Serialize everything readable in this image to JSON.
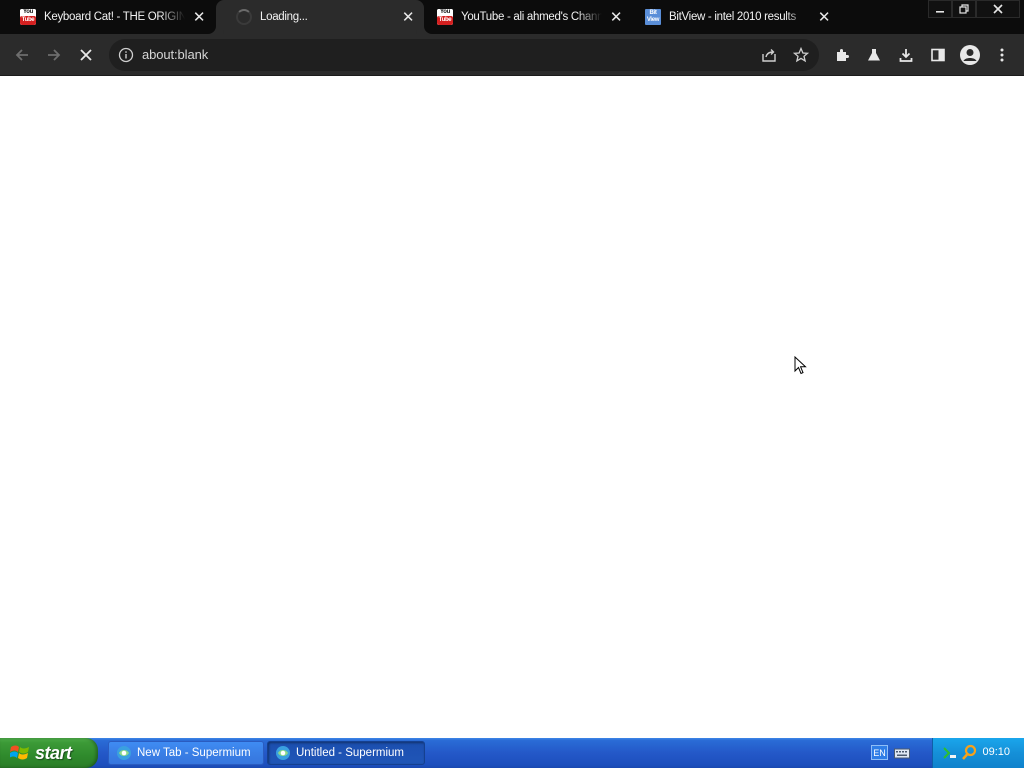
{
  "browser": {
    "tabs": [
      {
        "title": "Keyboard Cat! - THE ORIGINAL!",
        "favicon": "youtube-favicon",
        "active": false
      },
      {
        "title": "Loading...",
        "favicon": "loading-spinner",
        "active": true
      },
      {
        "title": "YouTube - ali ahmed's Channel",
        "favicon": "youtube-favicon",
        "active": false
      },
      {
        "title": "BitView - intel 2010 results",
        "favicon": "bitview-favicon",
        "active": false
      }
    ],
    "favicon_text": {
      "yt_top": "You",
      "yt_bottom": "Tube",
      "bitview": "Bit View"
    },
    "address": "about:blank",
    "window_controls": [
      "minimize",
      "restore",
      "close"
    ],
    "toolbar_icons": [
      "back-icon",
      "forward-icon",
      "stop-icon",
      "info-icon",
      "share-icon",
      "star-icon",
      "extensions-icon",
      "labs-icon",
      "download-icon",
      "side-panel-icon",
      "profile-icon",
      "menu-icon"
    ]
  },
  "taskbar": {
    "start_label": "start",
    "tasks": [
      {
        "label": "New Tab - Supermium",
        "active": false
      },
      {
        "label": "Untitled - Supermium",
        "active": true
      }
    ],
    "language": "EN",
    "clock": "09:10"
  },
  "colors": {
    "tabstrip_bg": "#0c0c0c",
    "toolbar_bg": "#2b2b2b",
    "taskbar_blue": "#2458c8",
    "start_green": "#2f8a2c",
    "tray_blue": "#1590d8"
  }
}
